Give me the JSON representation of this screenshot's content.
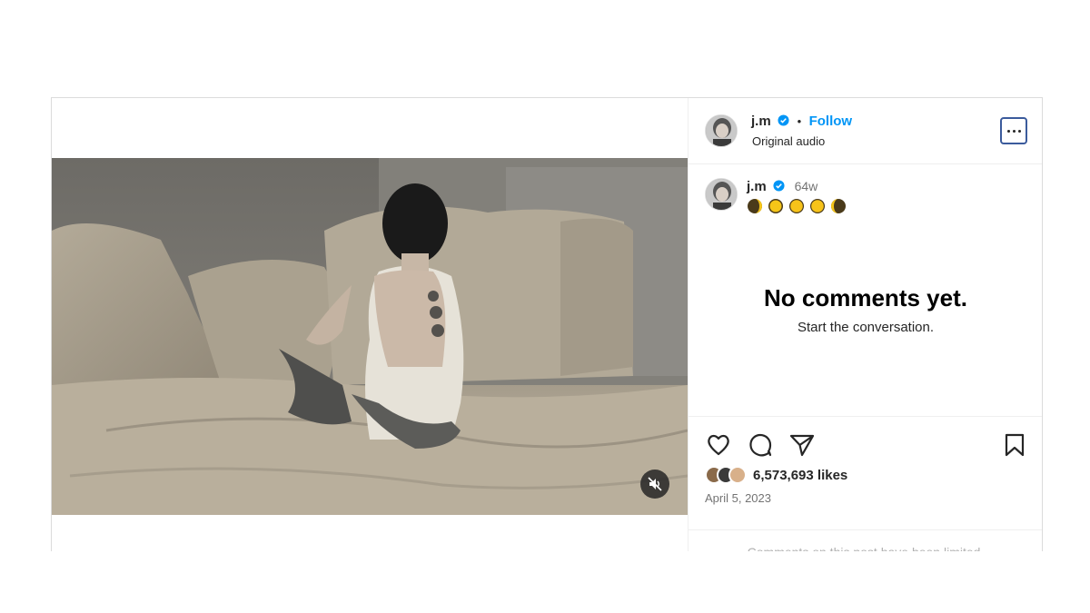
{
  "post": {
    "username": "j.m",
    "follow_label": "Follow",
    "separator": "•",
    "audio_label": "Original audio",
    "caption_emojis": [
      "waxing-crescent-moon",
      "first-quarter-moon",
      "full-moon",
      "full-moon",
      "waning-crescent-moon"
    ],
    "caption_time": "64w",
    "empty_title": "No comments yet.",
    "empty_subtitle": "Start the conversation.",
    "likes": "6,573,693 likes",
    "date": "April 5, 2023",
    "limited_notice": "Comments on this post have been limited."
  },
  "colors": {
    "accent": "#0095f6",
    "verified": "#0095f6",
    "muted_text": "#737373"
  },
  "icons": {
    "like": "heart-icon",
    "comment": "comment-icon",
    "share": "paper-plane-icon",
    "save": "bookmark-icon",
    "mute": "speaker-muted-icon",
    "more": "ellipsis-icon"
  }
}
